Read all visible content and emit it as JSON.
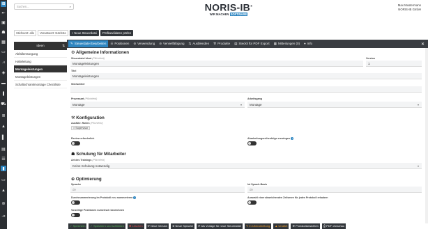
{
  "app": {
    "rail_logo": "IB"
  },
  "rail_icons": [
    "arrow-icon",
    "box-icon",
    "person-icon",
    "grid-icon",
    "monitor-icon",
    "chart-icon",
    "cap-icon",
    "folder-icon",
    "cart-icon",
    "doc-icon",
    "shield-icon",
    "stack-icon",
    "page-icon",
    "arrow-icon2",
    "person-icon2",
    "window-icon",
    "lock-icon",
    "help-icon",
    "logout-icon"
  ],
  "search": {
    "placeholder": "Suchen..."
  },
  "brand": {
    "name": "NORIS-IB",
    "reg": "®",
    "tagline_left": "WIR MACHEN",
    "tagline_right": "SOFTWARE"
  },
  "user": {
    "name": "Max Mustermann",
    "company": "NORIS-IB GmbH"
  },
  "toolbar2": {
    "status": "Stichwort: alle",
    "verantw": "Verantwort: Nächste",
    "new_btn": "+  Neue Steuerdatei",
    "pruef_btn": "Prüfkandidaten prüfen"
  },
  "sidenav": {
    "head": "Ideen",
    "items": [
      "Abfallentsorgung",
      "Halteleitung",
      "Montageleistungen",
      "Montageleistungen",
      "Schaltschrankmontage Checkliste"
    ]
  },
  "tabs": [
    "Steuerdatei bearbeiten",
    "Positionen",
    "Verwendung",
    "Vervielfältigung",
    "Ausblenden",
    "Produkte",
    "Steckli für PDF Export",
    "Mitteilungen (0)",
    "Info"
  ],
  "close": "✕",
  "form": {
    "general": {
      "title": "Allgemeine Informationen",
      "ident_label": "Steuerdatei Ident",
      "ident_req": "(Pflichtfeld)",
      "ident_value": "Montageleistungen",
      "version_label": "Version",
      "version_value": "1",
      "title_label": "Titel",
      "title_value": "Montageleistungen",
      "stichwort_label": "Stichwörter",
      "stichwort_value": "",
      "prozess_label": "Prozessart",
      "prozess_req": "(Pflichtfeld)",
      "prozess_value": "Montage",
      "arbeit_label": "Arbeitsgang",
      "arbeit_value": "Montage"
    },
    "config": {
      "title": "Konfiguration",
      "roles_label": "Ausführ. Rollen",
      "roles_req": "(Pflichtfeld)",
      "roles_tag": "× Supervisor",
      "review_label": "Review erforderlich",
      "abarb_label": "Abarbeitungsreihenfolge erzwingen"
    },
    "training": {
      "title": "Schulung für Mitarbeiter",
      "art_label": "Art des Trainings",
      "art_req": "(Pflichtfeld)",
      "art_value": "Keine Schulung notwendig"
    },
    "optim": {
      "title": "Optimierung",
      "sprache_label": "Sprache",
      "sprache_value": "de",
      "basis_label": "Ist Sprach-Basis",
      "basis_value": "de",
      "nummer_label": "Durchnummerierung im Protokoll neu nummerieren",
      "auswahl_label": "Auswahl einer abweichenden Zeilsenre für jedes Protokoll erlauben",
      "vorl_label": "Vorzeitige Positionen numerisch bezeichnen"
    }
  },
  "bottom": [
    "✓ Speichern",
    "✓ Speichern und schließen",
    "✖ Löschen",
    "⟳ Neue Version",
    "⊕ Neue Sprache",
    "⟳ Als Vorlage für neue Steuerdatei",
    "✎ In Überarbeitung",
    "▲ veraltet",
    "⚙ Protokollansichten",
    "⎙ PDF-Vorschau"
  ],
  "colors": {
    "accent": "#2e86c1",
    "dark": "#32363b"
  }
}
